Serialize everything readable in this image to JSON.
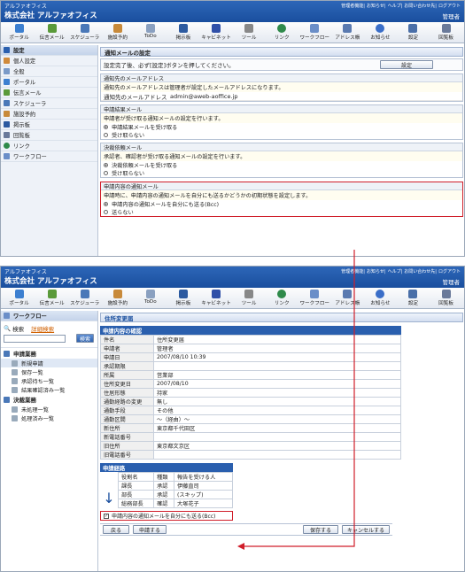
{
  "app_title": "アルファオフィス",
  "company": "株式会社 アルファオフィス",
  "header_links": [
    "管理者機能",
    "お知らせ",
    "ヘルプ",
    "お問い合わせ先",
    "ログアウト"
  ],
  "user_label": "管理者",
  "toolbar": [
    "ポータル",
    "伝言メール",
    "スケジューラ",
    "施設予約",
    "ToDo",
    "掲示板",
    "キャビネット",
    "ツール",
    "リンク",
    "ワークフロー",
    "アドレス帳",
    "お知らせ",
    "設定",
    "回覧板"
  ],
  "s1": {
    "side_items": [
      "設定",
      "個人設定",
      "全般",
      "ポータル",
      "伝言メール",
      "スケジューラ",
      "施設予約",
      "掲示板",
      "回覧板",
      "リンク",
      "ワークフロー"
    ],
    "page_title": "通知メールの設定",
    "instruction": "設定完了後、必ず[設定]ボタンを押してください。",
    "save_button": "設定",
    "addr": {
      "title": "通知先のメールアドレス",
      "desc": "通知先のメールアドレスは管理者が設定したメールアドレスになります。",
      "label": "通知先のメールアドレス",
      "value": "admin@aweb-aoffice.jp"
    },
    "result": {
      "title": "申請結果メール",
      "desc": "申請者が受け取る通知メールの設定を行います。",
      "opt1": "申請結果メールを受け取る",
      "opt2": "受け取らない"
    },
    "approval": {
      "title": "決裁依頼メール",
      "desc": "承認者、確認者が受け取る通知メールの設定を行います。",
      "opt1": "決裁依頼メールを受け取る",
      "opt2": "受け取らない"
    },
    "notify": {
      "title": "申請内容の通知メール",
      "desc": "申請時に、申請内容の通知メールを自分にも送るかどうかの初期状態を設定します。",
      "opt1": "申請内容の通知メールを自分にも送る(Bcc)",
      "opt2": "送らない"
    }
  },
  "s2": {
    "side_title": "ワークフロー",
    "search_label": "検索",
    "detail_search": "詳細検索",
    "search_button": "検索",
    "groups": [
      {
        "title": "申請業務",
        "items": [
          "新規申請",
          "保存一覧",
          "承認待ち一覧",
          "結果確認済み一覧"
        ]
      },
      {
        "title": "決裁業務",
        "items": [
          "未処理一覧",
          "処理済み一覧"
        ]
      }
    ],
    "page_title": "住所変更届",
    "section_content": "申請内容の確認",
    "fields": [
      [
        "件名",
        "住所変更届"
      ],
      [
        "申請者",
        "管理者"
      ],
      [
        "申請日",
        "2007/08/10 10:39"
      ],
      [
        "承認期限",
        ""
      ],
      [
        "所属",
        "営業部"
      ],
      [
        "住所変更日",
        "2007/08/10"
      ],
      [
        "住居形態",
        "持家"
      ],
      [
        "通勤経路の変更",
        "無し"
      ],
      [
        "通勤手段",
        "その他"
      ],
      [
        "通勤区間",
        "〜（経由）〜"
      ],
      [
        "新住所",
        "東京都千代田区"
      ],
      [
        "新電話番号",
        ""
      ],
      [
        "旧住所",
        "東京都文京区"
      ],
      [
        "旧電話番号",
        ""
      ]
    ],
    "section_route": "申請経路",
    "route_headers": [
      "役割名",
      "種類",
      "報告を受ける人"
    ],
    "route": [
      [
        "課長",
        "承認",
        "伊藤直司"
      ],
      [
        "部長",
        "承認",
        "(スキップ)"
      ],
      [
        "総務部長",
        "確認",
        "大塚花子"
      ]
    ],
    "checkbox_label": "申請内容の通知メールを自分にも送る(Bcc)",
    "buttons": {
      "back": "戻る",
      "apply": "申請する",
      "save": "保存する",
      "cancel": "キャンセルする"
    }
  },
  "colors": {
    "title_bar": "#1f57a6",
    "highlight": "#d01e2a",
    "section_blue": "#2a5fae"
  }
}
